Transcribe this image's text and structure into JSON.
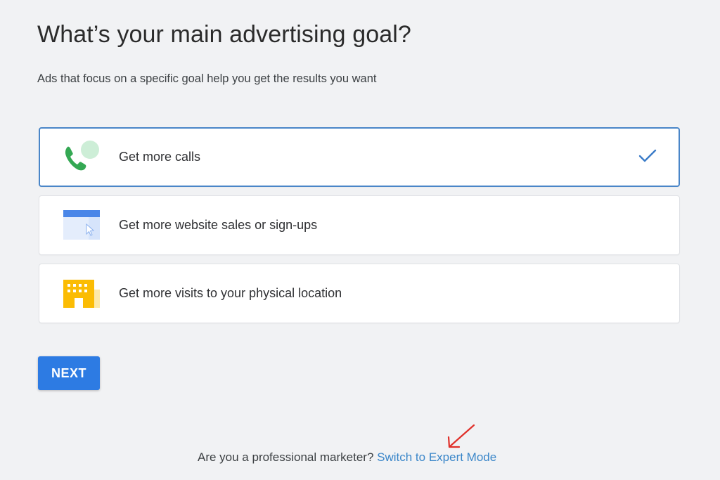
{
  "header": {
    "title": "What’s your main advertising goal?",
    "subtitle": "Ads that focus on a specific goal help you get the results you want"
  },
  "goals": [
    {
      "label": "Get more calls",
      "icon": "phone-call-icon",
      "selected": true
    },
    {
      "label": "Get more website sales or sign-ups",
      "icon": "website-cursor-icon",
      "selected": false
    },
    {
      "label": "Get more visits to your physical location",
      "icon": "building-icon",
      "selected": false
    }
  ],
  "actions": {
    "next_label": "NEXT"
  },
  "footer": {
    "question": "Are you a professional marketer?",
    "link_label": "Switch to Expert Mode"
  },
  "colors": {
    "accent": "#2d7be3",
    "selected_border": "#4a86c8",
    "link": "#3a86c9",
    "annotation_arrow": "#e0302a",
    "phone_green": "#34a853",
    "building_yellow": "#fbbc04"
  }
}
